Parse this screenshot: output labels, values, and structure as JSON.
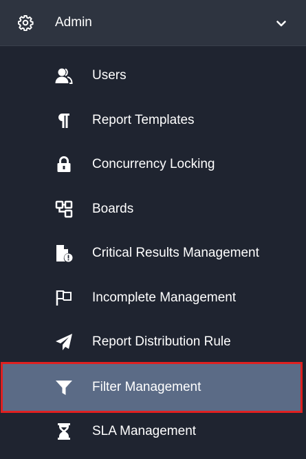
{
  "header": {
    "title": "Admin",
    "icon": "gear-icon",
    "chevron": "chevron-down-icon"
  },
  "items": [
    {
      "label": "Users",
      "icon": "users-icon"
    },
    {
      "label": "Report Templates",
      "icon": "paragraph-icon"
    },
    {
      "label": "Concurrency Locking",
      "icon": "lock-icon"
    },
    {
      "label": "Boards",
      "icon": "boards-icon"
    },
    {
      "label": "Critical Results Management",
      "icon": "file-alert-icon"
    },
    {
      "label": "Incomplete Management",
      "icon": "flag-icon"
    },
    {
      "label": "Report Distribution Rule",
      "icon": "paper-plane-icon"
    },
    {
      "label": "Filter Management",
      "icon": "filter-icon",
      "active": true
    },
    {
      "label": "SLA Management",
      "icon": "hourglass-icon"
    }
  ],
  "colors": {
    "sidebar_bg": "#1f2430",
    "header_bg": "#2e3440",
    "active_bg": "#5b6b86",
    "highlight_outline": "#e02020",
    "text": "#ffffff"
  }
}
